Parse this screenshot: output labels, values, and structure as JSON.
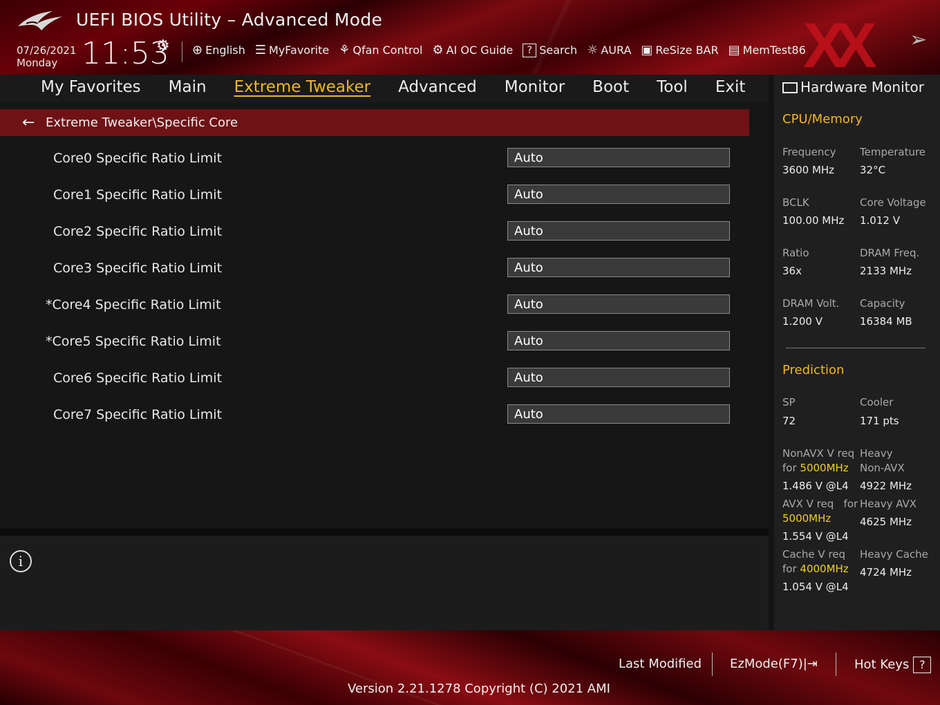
{
  "header": {
    "title": "UEFI BIOS Utility – Advanced Mode",
    "date": "07/26/2021",
    "day": "Monday",
    "time": "11:53",
    "brand_overlay": "XX"
  },
  "toolbar": [
    {
      "icon": "globe-icon",
      "glyph": "⊕",
      "label": "English"
    },
    {
      "icon": "favorite-icon",
      "glyph": "☰",
      "label": "MyFavorite"
    },
    {
      "icon": "fan-icon",
      "glyph": "⚘",
      "label": "Qfan Control"
    },
    {
      "icon": "ai-chip-icon",
      "glyph": "⚙",
      "label": "AI OC Guide"
    },
    {
      "icon": "search-help-icon",
      "glyph": "?",
      "label": "Search"
    },
    {
      "icon": "aura-light-icon",
      "glyph": "☼",
      "label": "AURA"
    },
    {
      "icon": "resize-bar-icon",
      "glyph": "▣",
      "label": "ReSize BAR"
    },
    {
      "icon": "memtest-icon",
      "glyph": "▤",
      "label": "MemTest86"
    }
  ],
  "menu": [
    {
      "label": "My Favorites",
      "active": false
    },
    {
      "label": "Main",
      "active": false
    },
    {
      "label": "Extreme Tweaker",
      "active": true
    },
    {
      "label": "Advanced",
      "active": false
    },
    {
      "label": "Monitor",
      "active": false
    },
    {
      "label": "Boot",
      "active": false
    },
    {
      "label": "Tool",
      "active": false
    },
    {
      "label": "Exit",
      "active": false
    }
  ],
  "breadcrumb": "Extreme Tweaker\\Specific Core",
  "settings": [
    {
      "label": "Core0 Specific Ratio Limit",
      "value": "Auto"
    },
    {
      "label": "Core1 Specific Ratio Limit",
      "value": "Auto"
    },
    {
      "label": "Core2 Specific Ratio Limit",
      "value": "Auto"
    },
    {
      "label": "Core3 Specific Ratio Limit",
      "value": "Auto"
    },
    {
      "label": "*Core4 Specific Ratio Limit",
      "value": "Auto"
    },
    {
      "label": "*Core5 Specific Ratio Limit",
      "value": "Auto"
    },
    {
      "label": "Core6 Specific Ratio Limit",
      "value": "Auto"
    },
    {
      "label": "Core7 Specific Ratio Limit",
      "value": "Auto"
    }
  ],
  "hardware_monitor": {
    "title": "Hardware Monitor",
    "cpu_memory_title": "CPU/Memory",
    "frequency_label": "Frequency",
    "frequency": "3600 MHz",
    "temperature_label": "Temperature",
    "temperature": "32°C",
    "bclk_label": "BCLK",
    "bclk": "100.00 MHz",
    "core_voltage_label": "Core Voltage",
    "core_voltage": "1.012 V",
    "ratio_label": "Ratio",
    "ratio": "36x",
    "dram_freq_label": "DRAM Freq.",
    "dram_freq": "2133 MHz",
    "dram_volt_label": "DRAM Volt.",
    "dram_volt": "1.200 V",
    "capacity_label": "Capacity",
    "capacity": "16384 MB",
    "prediction_title": "Prediction",
    "sp_label": "SP",
    "sp": "72",
    "cooler_label": "Cooler",
    "cooler": "171 pts",
    "nonavx_label_a": "NonAVX V req",
    "nonavx_label_for": "for",
    "nonavx_freq": "5000MHz",
    "nonavx_v": "1.486 V @L4",
    "heavy_nonavx_label_a": "Heavy",
    "heavy_nonavx_label_b": "Non-AVX",
    "heavy_nonavx": "4922 MHz",
    "avx_label_a": "AVX V req",
    "avx_label_for": "for",
    "avx_freq": "5000MHz",
    "avx_v": "1.554 V @L4",
    "heavy_avx_label": "Heavy AVX",
    "heavy_avx": "4625 MHz",
    "cache_label_a": "Cache V req",
    "cache_label_for": "for",
    "cache_freq": "4000MHz",
    "cache_v": "1.054 V @L4",
    "heavy_cache_label": "Heavy Cache",
    "heavy_cache": "4724 MHz"
  },
  "footer": {
    "last_modified": "Last Modified",
    "ezmode": "EzMode(F7)|",
    "hotkeys": "Hot Keys",
    "hotkeys_key": "?",
    "version": "Version 2.21.1278 Copyright (C) 2021 AMI"
  },
  "colors": {
    "accent": "#f1b52a",
    "breadcrumb_bg": "#6e1216",
    "highlight": "#f0d020",
    "brand_red": "#c4121c"
  }
}
